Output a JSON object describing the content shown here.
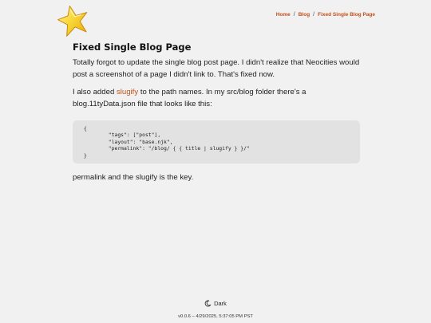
{
  "breadcrumb": {
    "home": "Home",
    "sep1": "/",
    "blog": "Blog",
    "sep2": "/",
    "current": "Fixed Single Blog Page"
  },
  "post": {
    "title": "Fixed Single Blog Page",
    "para1": "Totally forgot to update the single blog post page. I didn't realize that Neocities would post a screenshot of a page I didn't link to. That's fixed now.",
    "para2_before": "I also added ",
    "para2_link": "slugify",
    "para2_after": " to the path names. In my src/blog folder there's a blog.11tyData.json file that looks like this:",
    "code": "{\n        \"tags\": [\"post\"],\n        \"layout\": \"base.njk\",\n        \"permalink\": \"/blog/ { { title | slugify } }/\"\n}",
    "para3": "permalink and the slugify is the key."
  },
  "footer": {
    "theme_label": "Dark",
    "version": "v0.0.6 – 4/29/2025, 5:37:05 PM PST"
  },
  "colors": {
    "accent": "#c0501a",
    "background": "#f1f1f1",
    "code_bg": "#e2e2e2"
  },
  "icons": {
    "logo": "star-icon",
    "theme": "moon-icon"
  }
}
